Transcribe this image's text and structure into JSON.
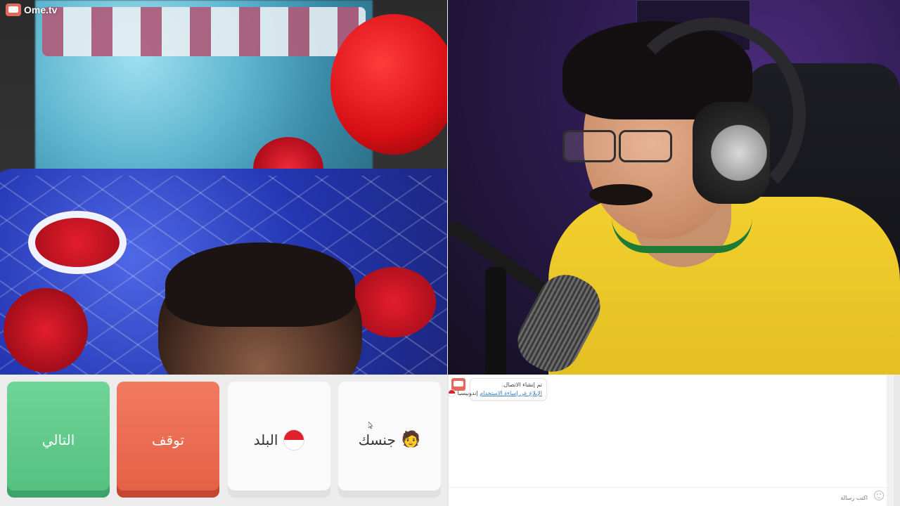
{
  "app": {
    "logo_text": "Ome.tv"
  },
  "controls": {
    "next_label": "التالي",
    "stop_label": "توقف",
    "country_label": "البلد",
    "gender_label": "جنسك",
    "gender_emoji": "🧑"
  },
  "chat": {
    "system_message": {
      "line1": "تم إنشاء الاتصال.",
      "line2_link": "الإبلاغ عن إساءة الاستخدام",
      "line2_country": "إندونيسيا"
    },
    "input_placeholder": "اكتب رسالة"
  },
  "colors": {
    "next": "#5cc787",
    "stop": "#e8674c",
    "panel": "#fafafa",
    "accent_logo": "#e26a5a"
  },
  "icons": [
    "indonesia-flag-icon",
    "person-emoji-icon",
    "smile-icon",
    "logo-icon"
  ]
}
